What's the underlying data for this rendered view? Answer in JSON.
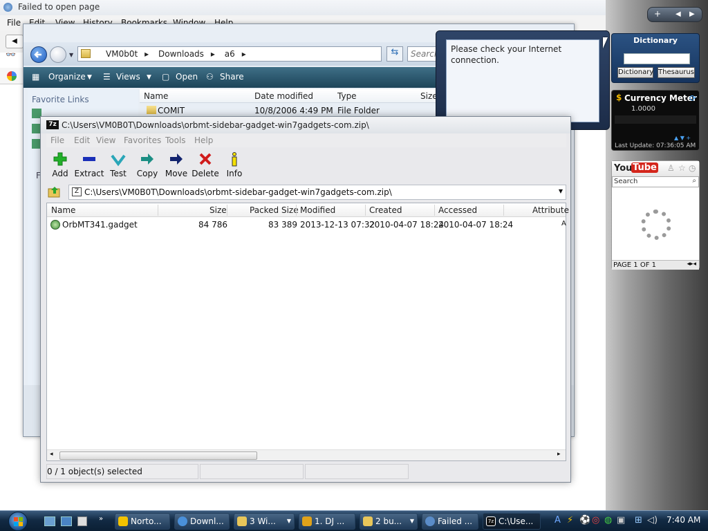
{
  "browser": {
    "title": "Failed to open page",
    "menu": [
      "File",
      "Edit",
      "View",
      "History",
      "Bookmarks",
      "Window",
      "Help"
    ]
  },
  "explorer": {
    "path": [
      "VM0b0t",
      "Downloads",
      "a6"
    ],
    "search_placeholder": "Search",
    "toolbar": {
      "organize": "Organize",
      "views": "Views",
      "open": "Open",
      "share": "Share"
    },
    "favorite_links": "Favorite Links",
    "left_letter": "F",
    "columns": [
      "Name",
      "Date modified",
      "Type",
      "Size"
    ],
    "rows": [
      {
        "name": "COMIT",
        "date": "10/8/2006 4:49 PM",
        "type": "File Folder",
        "size": ""
      }
    ]
  },
  "sevenzip": {
    "title": "C:\\Users\\VM0B0T\\Downloads\\orbmt-sidebar-gadget-win7gadgets-com.zip\\",
    "logo": "7z",
    "menu": [
      "File",
      "Edit",
      "View",
      "Favorites",
      "Tools",
      "Help"
    ],
    "tools": [
      {
        "label": "Add",
        "icon": "add-icon",
        "color": "#22b02a"
      },
      {
        "label": "Extract",
        "icon": "extract-icon",
        "color": "#1a2fb8"
      },
      {
        "label": "Test",
        "icon": "test-icon",
        "color": "#2aa6b8"
      },
      {
        "label": "Copy",
        "icon": "copy-icon",
        "color": "#1b8e84"
      },
      {
        "label": "Move",
        "icon": "move-icon",
        "color": "#12236e"
      },
      {
        "label": "Delete",
        "icon": "delete-icon",
        "color": "#d01c1c"
      },
      {
        "label": "Info",
        "icon": "info-icon",
        "color": "#d6b800"
      }
    ],
    "address": "C:\\Users\\VM0B0T\\Downloads\\orbmt-sidebar-gadget-win7gadgets-com.zip\\",
    "columns": [
      "Name",
      "Size",
      "Packed Size",
      "Modified",
      "Created",
      "Accessed",
      "Attribute"
    ],
    "rows": [
      {
        "name": "OrbMT341.gadget",
        "size": "84 786",
        "packed": "83 389",
        "modified": "2013-12-13 07:32",
        "created": "2010-04-07 18:24",
        "accessed": "2010-04-07 18:24",
        "attr": "A"
      }
    ],
    "status": "0 / 1 object(s) selected"
  },
  "popup": {
    "message": "Please check your Internet connection."
  },
  "gadgets": {
    "dictionary": {
      "title": "Dictionary",
      "btn_dictionary": "Dictionary",
      "btn_thesaurus": "Thesaurus"
    },
    "currency": {
      "title": "Currency Meter",
      "value": "1.0000",
      "update": "Last Update: 07:36:05 AM"
    },
    "youtube": {
      "logo_you": "You",
      "logo_tube": "Tube",
      "search": "Search",
      "page": "PAGE 1 OF 1"
    }
  },
  "taskbar": {
    "buttons": [
      {
        "label": "Norto...",
        "color": "#f2c200"
      },
      {
        "label": "Downl...",
        "color": "#4a90d9"
      },
      {
        "label": "3 Wi...",
        "color": "#e8c65a"
      },
      {
        "label": "1. DJ ...",
        "color": "#e0a21a"
      },
      {
        "label": "2 bu...",
        "color": "#e8c65a"
      },
      {
        "label": "Failed ...",
        "color": "#5a8cc8"
      },
      {
        "label": "C:\\Use...",
        "color": "#111111"
      }
    ],
    "clock": "7:40 AM"
  },
  "colors": {
    "accent": "#1c4459",
    "taskbar": "#122a44",
    "popup": "#1c2c48"
  }
}
